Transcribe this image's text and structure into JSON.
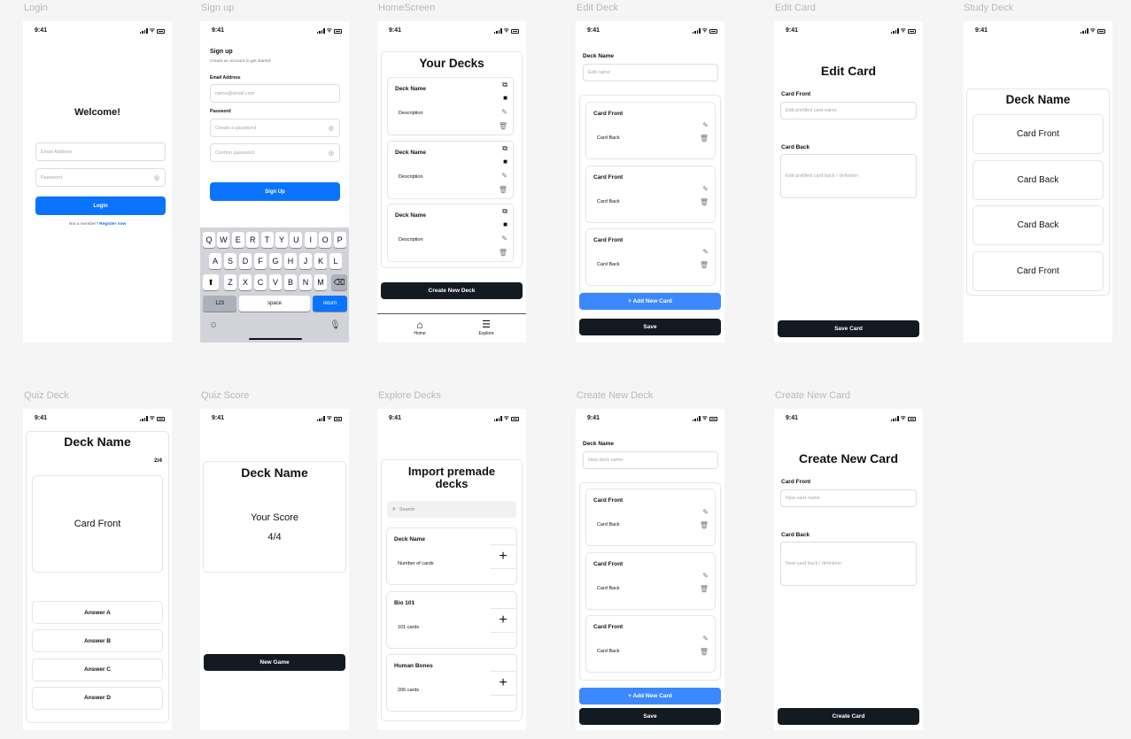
{
  "status_time": "9:41",
  "labels": [
    "Login",
    "Sign up",
    "HomeScreen",
    "Edit Deck",
    "Edit Card",
    "Study Deck",
    "Quiz Deck",
    "Quiz Score",
    "Explore Decks",
    "Create New Deck",
    "Create New Card"
  ],
  "login": {
    "title": "Welcome!",
    "email_placeholder": "Email Address",
    "password_placeholder": "Password",
    "button": "Login",
    "footer_text": "Not a member?",
    "footer_link": "Register now"
  },
  "signup": {
    "title": "Sign up",
    "subtitle": "Create an account to get started",
    "email_label": "Email Address",
    "email_placeholder": "name@email.com",
    "password_label": "Password",
    "password_placeholder": "Create a password",
    "confirm_placeholder": "Confirm password",
    "button": "Sign Up",
    "keyboard": {
      "row1": [
        "Q",
        "W",
        "E",
        "R",
        "T",
        "Y",
        "U",
        "I",
        "O",
        "P"
      ],
      "row2": [
        "A",
        "S",
        "D",
        "F",
        "G",
        "H",
        "J",
        "K",
        "L"
      ],
      "row3": [
        "Z",
        "X",
        "C",
        "V",
        "B",
        "N",
        "M"
      ],
      "num": "123",
      "space": "space",
      "ret": "return"
    }
  },
  "home": {
    "title": "Your Decks",
    "decks": [
      {
        "name": "Deck Name",
        "desc": "Description"
      },
      {
        "name": "Deck Name",
        "desc": "Description"
      },
      {
        "name": "Deck Name",
        "desc": "Description"
      }
    ],
    "button": "Create New Deck",
    "nav_home": "Home",
    "nav_explore": "Explore"
  },
  "edit_deck": {
    "label": "Deck Name",
    "placeholder": "Edit name",
    "cards": [
      {
        "front": "Card Front",
        "back": "Card Back"
      },
      {
        "front": "Card Front",
        "back": "Card Back"
      },
      {
        "front": "Card Front",
        "back": "Card Back"
      }
    ],
    "add_button": "+ Add New Card",
    "save_button": "Save"
  },
  "edit_card": {
    "title": "Edit Card",
    "front_label": "Card Front",
    "front_placeholder": "Edit prefilled card name",
    "back_label": "Card Back",
    "back_placeholder": "Edit prefilled card back / definition",
    "button": "Save Card"
  },
  "study": {
    "title": "Deck Name",
    "cards": [
      "Card Front",
      "Card Back",
      "Card Back",
      "Card Front"
    ]
  },
  "quiz": {
    "title": "Deck Name",
    "progress": "2/4",
    "card": "Card Front",
    "answers": [
      "Answer A",
      "Answer B",
      "Answer C",
      "Answer D"
    ]
  },
  "score": {
    "title": "Deck Name",
    "label": "Your Score",
    "value": "4/4",
    "button": "New Game"
  },
  "explore": {
    "title": "Import premade decks",
    "search_placeholder": "Search",
    "decks": [
      {
        "name": "Deck Name",
        "count": "Number of cards"
      },
      {
        "name": "Bio 101",
        "count": "101 cards"
      },
      {
        "name": "Human Bones",
        "count": "206 cards"
      }
    ]
  },
  "create_deck": {
    "label": "Deck Name",
    "placeholder": "New deck name",
    "cards": [
      {
        "front": "Card Front",
        "back": "Card Back"
      },
      {
        "front": "Card Front",
        "back": "Card Back"
      },
      {
        "front": "Card Front",
        "back": "Card Back"
      }
    ],
    "add_button": "+ Add New Card",
    "save_button": "Save"
  },
  "create_card": {
    "title": "Create New Card",
    "front_label": "Card Front",
    "front_placeholder": "New card name",
    "back_label": "Card Back",
    "back_placeholder": "New card back / definition",
    "button": "Create Card"
  },
  "colors": {
    "primary_blue": "#0a74ff",
    "light_blue": "#3b88ff",
    "dark_button": "#141a22"
  }
}
